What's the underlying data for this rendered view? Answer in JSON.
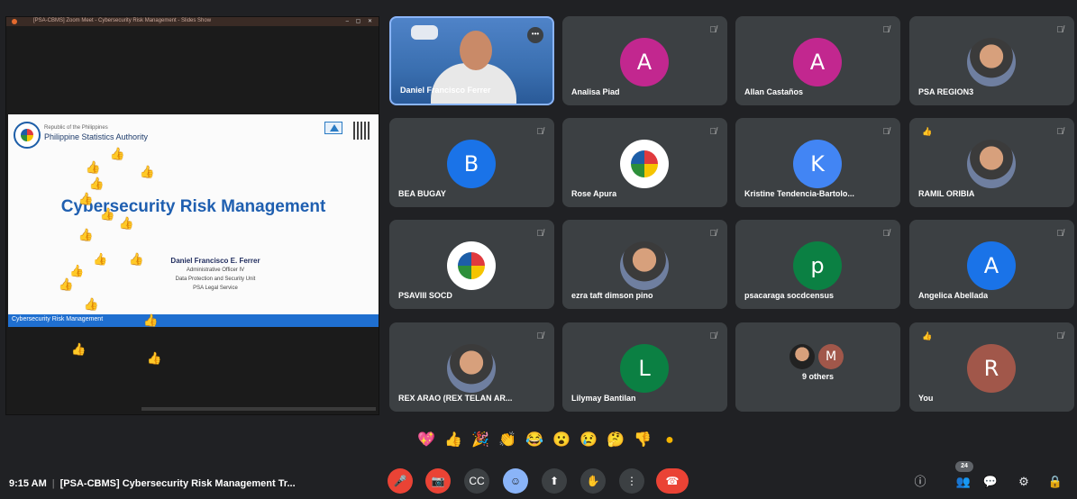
{
  "window": {
    "title": "[PSA-CBMS] Zoom Meet - Cybersecurity Risk Management - Slides Show"
  },
  "slide": {
    "republic": "Republic of the Philippines",
    "agency": "Philippine Statistics Authority",
    "title": "Cybersecurity Risk Management",
    "presenter": "Daniel Francisco E. Ferrer",
    "position": "Administrative Officer IV",
    "unit": "Data Protection and Security Unit",
    "service": "PSA Legal Service",
    "footer": "Cybersecurity Risk Management"
  },
  "participants": [
    {
      "name": "Daniel Francisco Ferrer",
      "type": "video",
      "active": true
    },
    {
      "name": "Analisa Piad",
      "initial": "A",
      "color": "#c2278f",
      "muted": true
    },
    {
      "name": "Allan Castaños",
      "initial": "A",
      "color": "#c2278f",
      "muted": true
    },
    {
      "name": "PSA REGION3",
      "type": "photo",
      "muted": true
    },
    {
      "name": "BEA BUGAY",
      "initial": "B",
      "color": "#1a73e8",
      "muted": true
    },
    {
      "name": "Rose Apura",
      "type": "logo",
      "muted": true
    },
    {
      "name": "Kristine Tendencia-Bartolo...",
      "initial": "K",
      "color": "#4285f4",
      "muted": true
    },
    {
      "name": "RAMIL ORIBIA",
      "type": "photo",
      "muted": true,
      "hand": true
    },
    {
      "name": "PSAVIII SOCD",
      "type": "logo",
      "muted": true
    },
    {
      "name": "ezra taft dimson pino",
      "type": "photo",
      "muted": true
    },
    {
      "name": "psacaraga socdcensus",
      "initial": "p",
      "color": "#0b8043",
      "muted": true
    },
    {
      "name": "Angelica Abellada",
      "initial": "A",
      "color": "#1a73e8",
      "muted": true
    },
    {
      "name": "REX ARAO (REX TELAN AR...",
      "type": "photo",
      "muted": true
    },
    {
      "name": "Lilymay Bantilan",
      "initial": "L",
      "color": "#0b8043",
      "muted": true
    },
    {
      "name": "9 others",
      "type": "others",
      "initial": "M"
    },
    {
      "name": "You",
      "initial": "R",
      "color": "#a1574a",
      "muted": true,
      "hand": true
    }
  ],
  "reactions": [
    "💖",
    "👍",
    "🎉",
    "👏",
    "😂",
    "😮",
    "😢",
    "🤔",
    "👎",
    "●"
  ],
  "bottom": {
    "time": "9:15 AM",
    "meeting": "[PSA-CBMS] Cybersecurity Risk Management Tr...",
    "participant_count": "24"
  },
  "icons": {
    "mic_off": "mic-off-icon",
    "cam_off": "camera-off-icon",
    "captions": "captions-icon",
    "emoji": "emoji-icon",
    "present": "present-icon",
    "hand": "raise-hand-icon",
    "more": "more-options-icon",
    "end": "end-call-icon"
  },
  "colors": {
    "accent": "#8ab4f8",
    "danger": "#ea4335",
    "tile": "#3c4043",
    "background": "#202124"
  }
}
